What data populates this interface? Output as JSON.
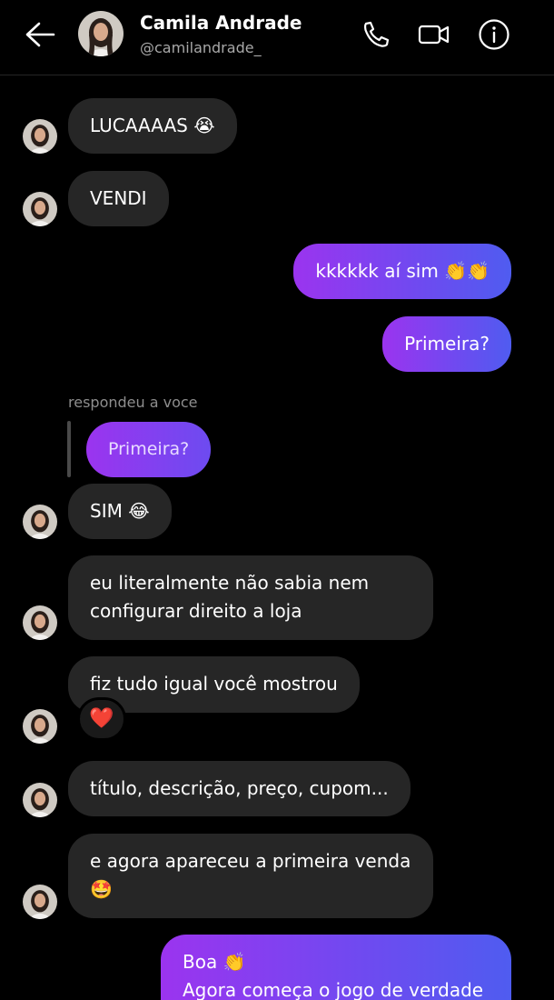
{
  "header": {
    "name": "Camila Andrade",
    "handle": "@camilandrade_"
  },
  "messages": {
    "m1": "LUCAAAAS 😭",
    "m2": "VENDI",
    "m3": "kkkkkk aí sim 👏👏",
    "m4": "Primeira?",
    "reply_label": "respondeu a voce",
    "reply_quote": "Primeira?",
    "m5": "SIM 😂",
    "m6": "eu literalmente não sabia nem\nconfigurar direito a loja",
    "m7": "fiz tudo igual você mostrou",
    "reaction": "❤️",
    "m8": "título, descrição, preço, cupom...",
    "m9": "e agora apareceu a primeira venda\n🤩",
    "m10": "Boa 👏\nAgora começa o jogo de verdade"
  },
  "colors": {
    "background": "#000000",
    "incoming_bubble": "#262626",
    "outgoing_gradient_start": "#9b34ef",
    "outgoing_gradient_end": "#4f5cf0"
  },
  "icons": [
    "back-arrow-icon",
    "phone-icon",
    "video-camera-icon",
    "info-icon"
  ]
}
